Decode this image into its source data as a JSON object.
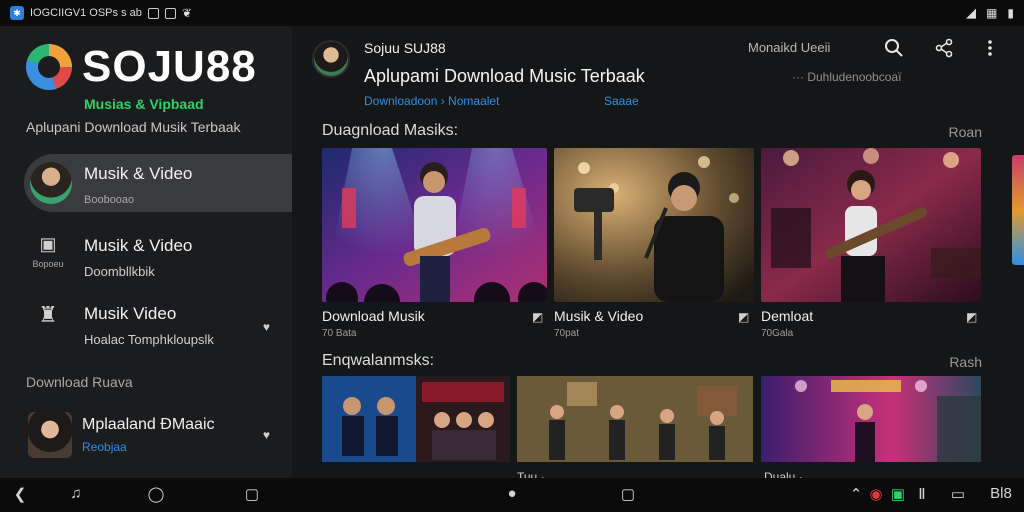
{
  "status_bar": {
    "left_text": "IOGCIIGV1 OSPs s ab",
    "app_icon": "app-badge-icon",
    "right_icons": [
      "wifi-icon",
      "signal-icon",
      "battery-icon"
    ],
    "battery_text": "▒"
  },
  "sidebar": {
    "brand_name": "SOJU88",
    "brand_tagline": "Musias & Vipbaad",
    "brand_subtitle": "Aplupani Download Musik Terbaak",
    "items": [
      {
        "title": "Musik & Video",
        "sub": "Boobooao"
      },
      {
        "title": "Musik & Video",
        "sub": "Doombllkbik",
        "icon_caption": "Bopoeu"
      },
      {
        "title": "Musik Video",
        "sub": "Hoalac Tomphkloupslk"
      }
    ],
    "section_label": "Download Ruava",
    "download_item": {
      "title": "Mplaaland ÐMaaic",
      "sub": "Reobjaa"
    }
  },
  "main": {
    "channel_name": "Sojuu SUJ88",
    "channel_title": "Aplupami Download Music Terbaak",
    "channel_link": "Downloadoon › Nomaalet",
    "channel_link2": "Saaae",
    "top_label": "Monaikd Ueeii",
    "top_sublabel": "··· Duhludenoobcoaï",
    "section1": {
      "title": "Duagnload Masiks:",
      "more": "Roan"
    },
    "cards": [
      {
        "label": "Download Musik",
        "sub": "70 Bata"
      },
      {
        "label": "Musik & Video",
        "sub": "70pat"
      },
      {
        "label": "Demloat",
        "sub": "70Gala"
      }
    ],
    "section2": {
      "title": "Enqwalanmsks:",
      "more": "Rash"
    },
    "thumb_labels": [
      "",
      "Tuu ·",
      "Dualu ·"
    ]
  },
  "nav_bar": {
    "right_text": "Bl8"
  }
}
